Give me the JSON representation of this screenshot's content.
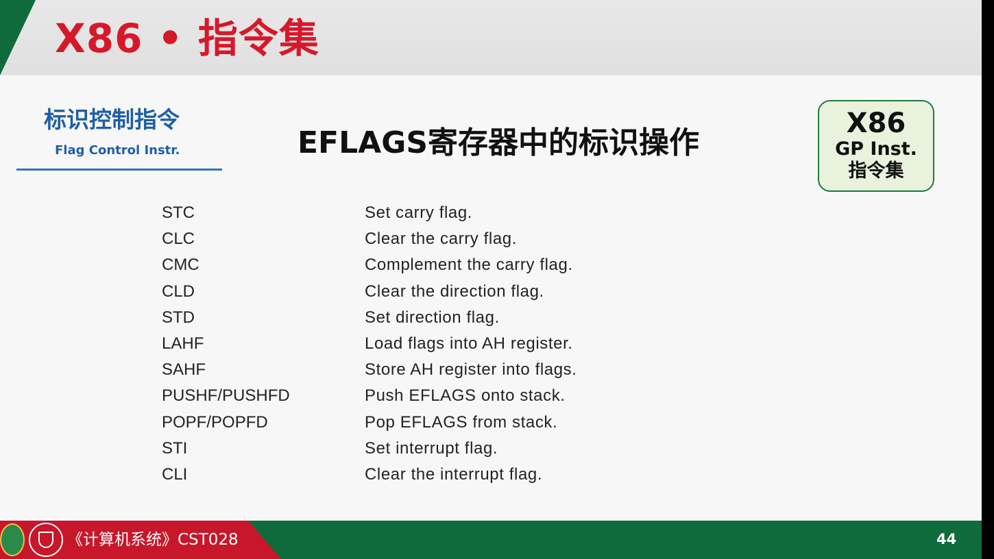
{
  "header": {
    "title": "X86 • 指令集"
  },
  "section": {
    "title_cn": "标识控制指令",
    "title_en": "Flag Control Instr."
  },
  "main_title": "EFLAGS寄存器中的标识操作",
  "badge": {
    "line1": "X86",
    "line2": "GP Inst.",
    "line3": "指令集"
  },
  "instructions": [
    {
      "mnemonic": "STC",
      "description": "Set carry flag."
    },
    {
      "mnemonic": "CLC",
      "description": "Clear the carry flag."
    },
    {
      "mnemonic": "CMC",
      "description": "Complement the carry flag."
    },
    {
      "mnemonic": "CLD",
      "description": "Clear the direction flag."
    },
    {
      "mnemonic": "STD",
      "description": "Set direction flag."
    },
    {
      "mnemonic": "LAHF",
      "description": "Load flags into AH register."
    },
    {
      "mnemonic": "SAHF",
      "description": "Store AH register into flags."
    },
    {
      "mnemonic": "PUSHF/PUSHFD",
      "description": "Push EFLAGS onto stack."
    },
    {
      "mnemonic": "POPF/POPFD",
      "description": "Pop EFLAGS from stack."
    },
    {
      "mnemonic": "STI",
      "description": "Set interrupt flag."
    },
    {
      "mnemonic": "CLI",
      "description": "Clear the interrupt flag."
    }
  ],
  "footer": {
    "course": "《计算机系统》CST028",
    "page_number": "44"
  },
  "colors": {
    "title_red": "#d6192a",
    "green": "#0f6b3c",
    "blue": "#1f5fa5",
    "footer_red": "#c8162a"
  }
}
